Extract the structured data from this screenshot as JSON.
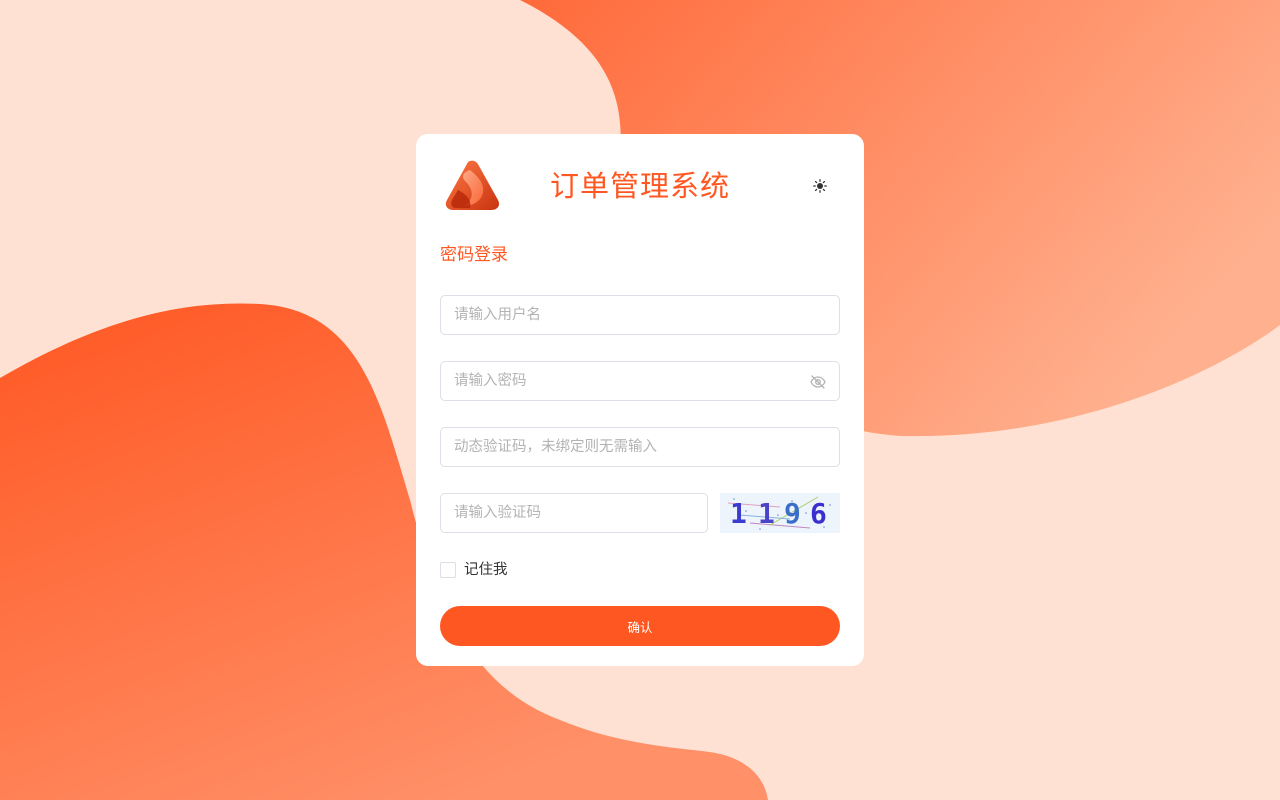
{
  "app": {
    "title": "订单管理系统"
  },
  "login": {
    "tab_title": "密码登录",
    "username": {
      "value": "",
      "placeholder": "请输入用户名"
    },
    "password": {
      "value": "",
      "placeholder": "请输入密码"
    },
    "otp": {
      "value": "",
      "placeholder": "动态验证码，未绑定则无需输入"
    },
    "captcha": {
      "value": "",
      "placeholder": "请输入验证码",
      "image_text": "1196"
    },
    "remember_label": "记住我",
    "remember_checked": false,
    "submit_label": "确认"
  },
  "icons": {
    "logo": "brand-logo",
    "theme": "sun-icon",
    "password_toggle": "eye-off-icon"
  },
  "colors": {
    "accent": "#ff5722",
    "background": "#ffe1d3"
  }
}
